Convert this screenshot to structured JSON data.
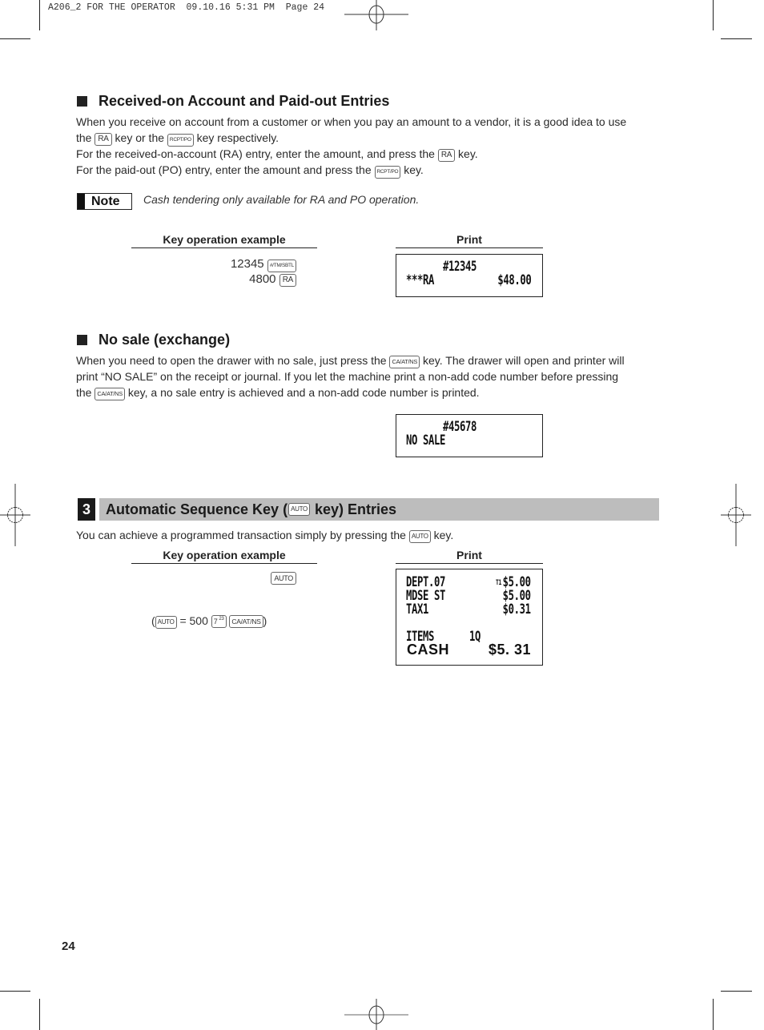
{
  "slug": "A206_2 FOR THE OPERATOR  09.10.16 5:31 PM  Page 24",
  "section_ra_po": {
    "heading": "Received-on Account and Paid-out Entries",
    "para1_a": "When you receive on account from a customer or when you pay an amount to a vendor, it is a good idea to use",
    "para1_b": "the",
    "para1_c": "key or the",
    "para1_d": "key respectively.",
    "para2_a": "For the received-on-account (RA) entry, enter the amount, and press the",
    "para2_b": "key.",
    "para3_a": "For the paid-out (PO) entry, enter the amount and press the",
    "para3_b": "key.",
    "keys": {
      "ra": "RA",
      "rcpt_po": "RCPT/PO"
    },
    "note_label": "Note",
    "note_text": "Cash tendering only available for RA and PO operation.",
    "key_op_header": "Key operation example",
    "print_header": "Print",
    "key_ops": [
      {
        "value": "12345",
        "key": "#/TM/SBTL"
      },
      {
        "value": "4800",
        "key": "RA"
      }
    ],
    "receipt": {
      "line1": "#12345",
      "line2_left": "***RA",
      "line2_right": "$48.00"
    }
  },
  "section_no_sale": {
    "heading": "No sale (exchange)",
    "line1_a": "When you need to open the drawer with no sale, just press the",
    "line1_b": "key.  The drawer will open and printer will",
    "line2": "print “NO SALE” on the receipt or journal.  If you let the machine print a non-add code number before pressing",
    "line3_a": "the",
    "line3_b": "key, a no sale entry is achieved and a non-add code number is printed.",
    "key": "CA/AT/NS",
    "receipt": {
      "line1": "#45678",
      "line2": "NO SALE"
    }
  },
  "section_auto": {
    "number": "3",
    "title_a": "Automatic Sequence Key (",
    "title_key": "AUTO",
    "title_b": " key) Entries",
    "desc_a": "You can achieve a programmed transaction simply by pressing the",
    "desc_b": "key.",
    "key_op_header": "Key operation example",
    "print_header": "Print",
    "key_op_key": "AUTO",
    "definition": {
      "open": "(",
      "key": "AUTO",
      "equals": "= 500",
      "dept_key_main": "7",
      "dept_key_sup": "23",
      "tender_key": "CA/AT/NS",
      "close": ")"
    },
    "receipt": {
      "rows": [
        {
          "left": "DEPT.07",
          "mark": "T1",
          "right": "$5.00"
        },
        {
          "left": "MDSE ST",
          "mark": "",
          "right": "$5.00"
        },
        {
          "left": "TAX1",
          "mark": "",
          "right": "$0.31"
        }
      ],
      "items_label": "ITEMS",
      "items_value": "1Q",
      "cash_label": "CASH",
      "cash_value": "$5. 31"
    }
  },
  "page_number": "24"
}
